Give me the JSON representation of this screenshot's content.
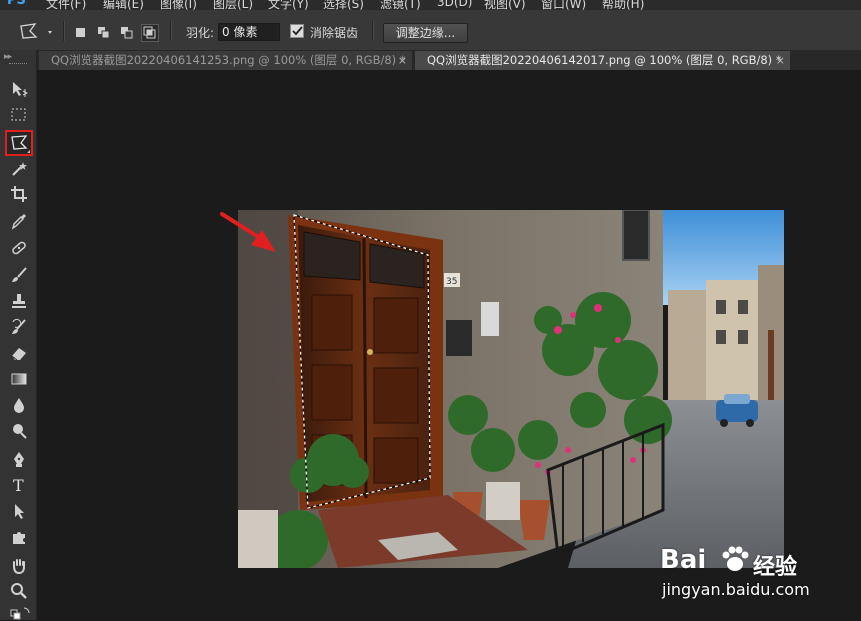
{
  "app": {
    "logo": "PS",
    "menu": [
      "文件(F)",
      "编辑(E)",
      "图像(I)",
      "图层(L)",
      "文字(Y)",
      "选择(S)",
      "滤镜(T)",
      "3D(D)",
      "视图(V)",
      "窗口(W)",
      "帮助(H)"
    ]
  },
  "options": {
    "feather_label": "羽化:",
    "feather_value": "0 像素",
    "antialias_label": "消除锯齿",
    "antialias_checked": true,
    "refine_edge_label": "调整边缘..."
  },
  "tabs": [
    {
      "label": "QQ浏览器截图20220406141253.png @ 100% (图层 0, RGB/8) *",
      "active": false,
      "close": "×"
    },
    {
      "label": "QQ浏览器截图20220406142017.png @ 100% (图层 0, RGB/8) *",
      "active": true,
      "close": "×"
    }
  ],
  "tools": [
    "move-tool",
    "marquee-tool",
    "polygonal-lasso-tool",
    "magic-wand-tool",
    "crop-tool",
    "eyedropper-tool",
    "healing-brush-tool",
    "brush-tool",
    "clone-stamp-tool",
    "history-brush-tool",
    "eraser-tool",
    "gradient-tool",
    "blur-tool",
    "dodge-tool",
    "pen-tool",
    "type-tool",
    "path-selection-tool",
    "custom-shape-tool",
    "hand-tool",
    "zoom-tool"
  ],
  "selected_tool": "polygonal-lasso-tool",
  "type_tool_glyph": "T",
  "photo": {
    "house_number": "35"
  },
  "watermark": {
    "brand_left": "Bai",
    "brand_right": "经验",
    "url": "jingyan.baidu.com"
  },
  "colors": {
    "accent_red": "#e02020",
    "ps_blue": "#3da8f5",
    "panel": "#383838"
  }
}
